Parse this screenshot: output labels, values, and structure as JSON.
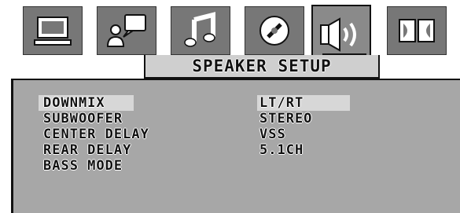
{
  "screen": {
    "title": "SPEAKER SETUP",
    "tabs": [
      {
        "icon": "monitor-icon"
      },
      {
        "icon": "person-speech-icon"
      },
      {
        "icon": "music-note-icon"
      },
      {
        "icon": "disc-icon"
      },
      {
        "icon": "speaker-icon"
      },
      {
        "icon": "dolby-icon"
      }
    ],
    "settings": [
      {
        "label": "DOWNMIX",
        "value": "LT/RT"
      },
      {
        "label": "SUBWOOFER",
        "value": "STEREO"
      },
      {
        "label": "CENTER DELAY",
        "value": "VSS"
      },
      {
        "label": "REAR DELAY",
        "value": "5.1CH"
      },
      {
        "label": "BASS MODE",
        "value": ""
      }
    ]
  },
  "colors": {
    "panel": "#a7a7a7",
    "tab": "#777777",
    "highlight": "#d7d7d7"
  }
}
